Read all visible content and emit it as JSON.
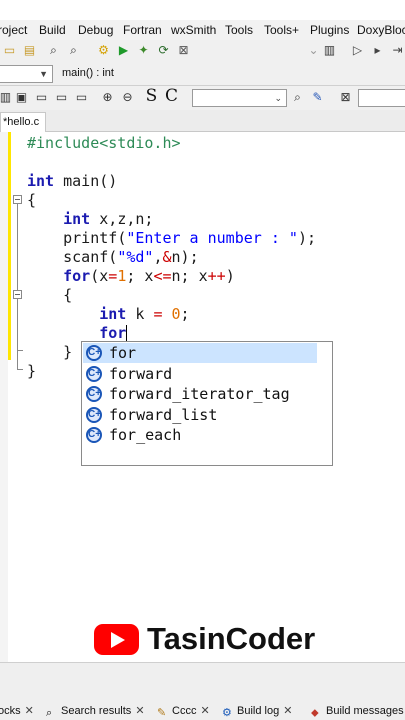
{
  "menubar": {
    "items": [
      "roject",
      "Build",
      "Debug",
      "Fortran",
      "wxSmith",
      "Tools",
      "Tools+",
      "Plugins",
      "DoxyBlock"
    ]
  },
  "toolbar": {
    "function_combo": "main() : int",
    "search_combo": "",
    "format_letters": [
      "S",
      "C"
    ]
  },
  "editor": {
    "tab_label": "*hello.c",
    "code_lines": [
      "#include<stdio.h>",
      "",
      "int main()",
      "{",
      "    int x,z,n;",
      "    printf(\"Enter a number : \");",
      "    scanf(\"%d\",&n);",
      "    for(x=1; x<=n; x++)",
      "    {",
      "        int k = 0;",
      "        for",
      "    }",
      "}"
    ]
  },
  "autocomplete": {
    "items": [
      "for",
      "forward",
      "forward_iterator_tag",
      "forward_list",
      "for_each"
    ],
    "selected_index": 0,
    "icon_glyph": "C+"
  },
  "watermark": {
    "brand": "TasinCoder"
  },
  "log_tabs": [
    {
      "label": "ocks"
    },
    {
      "label": "Search results"
    },
    {
      "label": "Cccc"
    },
    {
      "label": "Build log"
    },
    {
      "label": "Build messages"
    }
  ],
  "colors": {
    "keyword": "#1b1bb0",
    "preprocessor": "#2e8b57",
    "string": "#0000ff",
    "number": "#e07000",
    "operator": "#cc0000",
    "selection": "#cce4ff",
    "change_bar": "#ffe600"
  }
}
